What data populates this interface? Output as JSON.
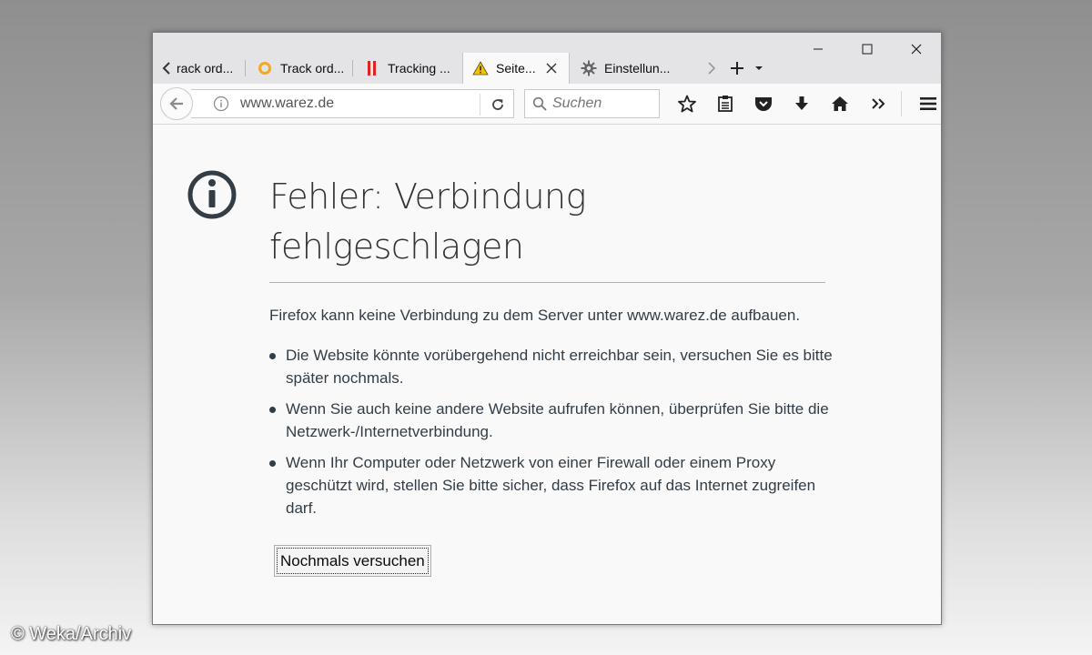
{
  "window": {
    "controls": {
      "minimize_icon": "minimize-icon",
      "maximize_icon": "maximize-icon",
      "close_icon": "close-icon"
    }
  },
  "tabs": [
    {
      "label": "rack ord...",
      "icon": "none",
      "active": false
    },
    {
      "label": "Track ord...",
      "icon": "orange-ring-icon",
      "active": false
    },
    {
      "label": "Tracking ...",
      "icon": "red-bars-icon",
      "active": false
    },
    {
      "label": "Seite...",
      "icon": "warning-icon",
      "active": true
    },
    {
      "label": "Einstellun...",
      "icon": "gear-icon",
      "active": false
    }
  ],
  "navbar": {
    "url": "www.warez.de",
    "search_placeholder": "Suchen"
  },
  "error_page": {
    "title": "Fehler: Verbindung fehlgeschlagen",
    "description": "Firefox kann keine Verbindung zu dem Server unter www.warez.de aufbauen.",
    "items": [
      "Die Website könnte vorübergehend nicht erreichbar sein, versuchen Sie es bitte später nochmals.",
      "Wenn Sie auch keine andere Website aufrufen können, überprüfen Sie bitte die Netzwerk-/Internetverbindung.",
      "Wenn Ihr Computer oder Netzwerk von einer Firewall oder einem Proxy geschützt wird, stellen Sie bitte sicher, dass Firefox auf das Internet zugreifen darf."
    ],
    "retry_label": "Nochmals versuchen"
  },
  "credit": "© Weka/Archiv",
  "colors": {
    "title_text": "#333333",
    "body_text": "#333d46",
    "warning_yellow": "#f5c400",
    "tab_ring_orange": "#f5a623",
    "tab_bars_red": "#e02424"
  }
}
